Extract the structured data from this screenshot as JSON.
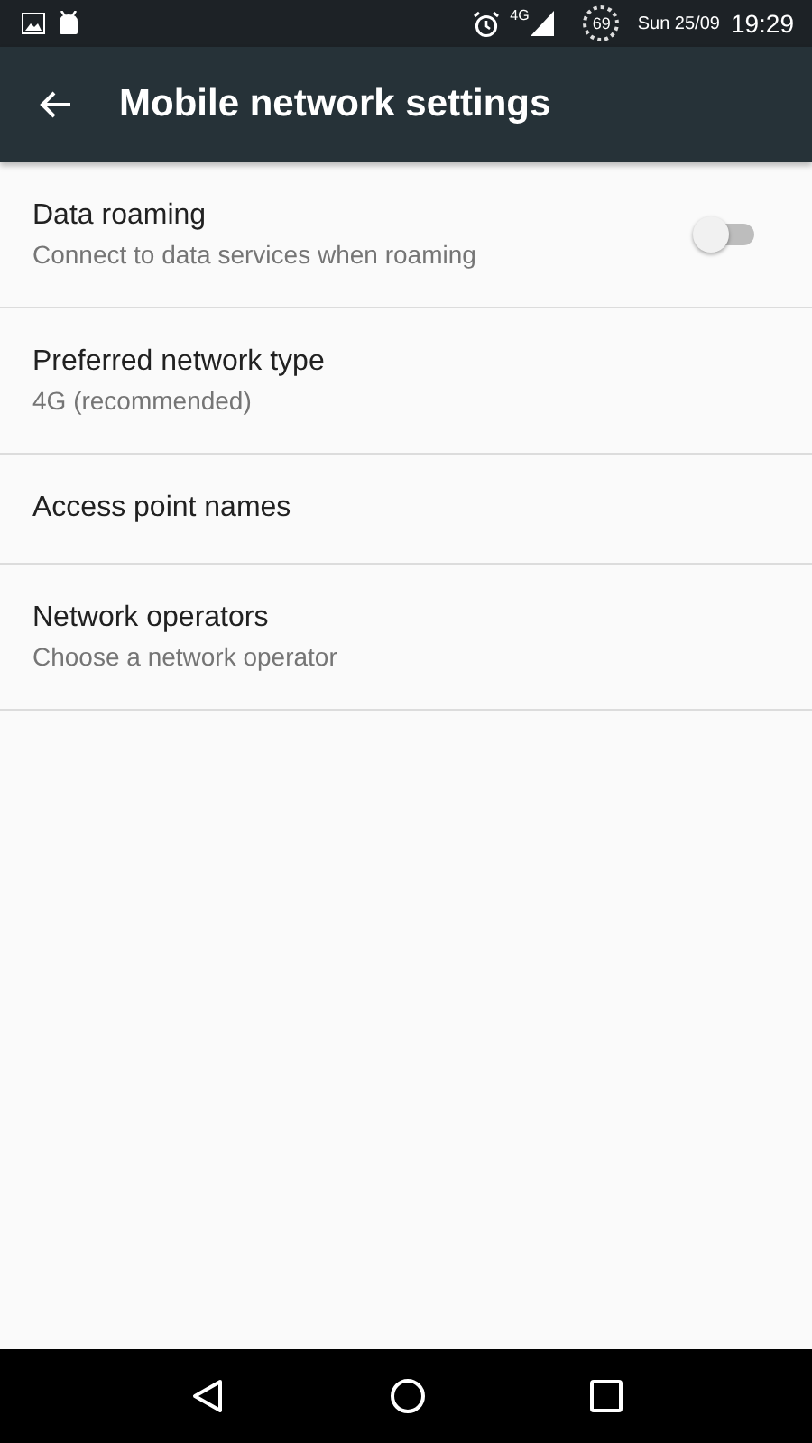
{
  "status_bar": {
    "network": "4G",
    "battery": "69",
    "date": "Sun 25/09",
    "time": "19:29"
  },
  "app_bar": {
    "title": "Mobile network settings"
  },
  "settings": [
    {
      "kind": "switch",
      "title": "Data roaming",
      "summary": "Connect to data services when roaming",
      "on": false
    },
    {
      "kind": "plain",
      "title": "Preferred network type",
      "summary": "4G (recommended)"
    },
    {
      "kind": "plain",
      "title": "Access point names"
    },
    {
      "kind": "plain",
      "title": "Network operators",
      "summary": "Choose a network operator"
    }
  ]
}
